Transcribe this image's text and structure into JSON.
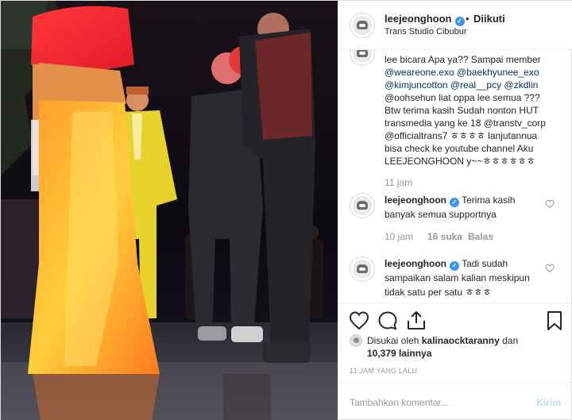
{
  "header": {
    "username": "leejeonghoon",
    "dot": "•",
    "follow_status": "Diikuti",
    "location": "Trans Studio Cibubur"
  },
  "caption": {
    "lines": [
      "lee bicara Apa ya?? Sampai member",
      "@weareone.exo @baekhyunee_exo",
      "@kimjuncotton @real__pcy @zkdlin",
      "@oohsehun liat oppa lee semua ???",
      "Btw terima kasih Sudah nonton HUT",
      "transmedia yang ke 18 @transtv_corp",
      "@officialtrans7 ㅎㅎㅎㅎ lanjutannua",
      "bisa check ke youtube channel Aku",
      "LEEJEONGHOON y~~ㅎㅎㅎㅎㅎㅎ"
    ],
    "time": "11 jam"
  },
  "comments": [
    {
      "username": "leejeonghoon",
      "text_line1": "Terima kasih",
      "text_line2": "banyak semua supportnya",
      "time": "10 jam",
      "likes": "16 suka",
      "reply": "Balas"
    },
    {
      "username": "leejeonghoon",
      "text_line1": "Tadi sudah",
      "text_line2": "sampaikan salam kalian meskipun",
      "text_line3": "tidak satu per satu ㅎㅎㅎ"
    }
  ],
  "likes_summary": {
    "prefix": "Disukai oleh",
    "user": "kalinaocktaranny",
    "and": "dan",
    "count": "10,379 lainnya"
  },
  "timestamp": "11 JAM YANG LALU",
  "add_comment": {
    "placeholder": "Tambahkan komentar...",
    "post_label": "Kirim"
  },
  "colors": {
    "verified": "#3897f0",
    "mention": "#003569",
    "muted": "#999999",
    "post_button": "#b2dffc"
  }
}
